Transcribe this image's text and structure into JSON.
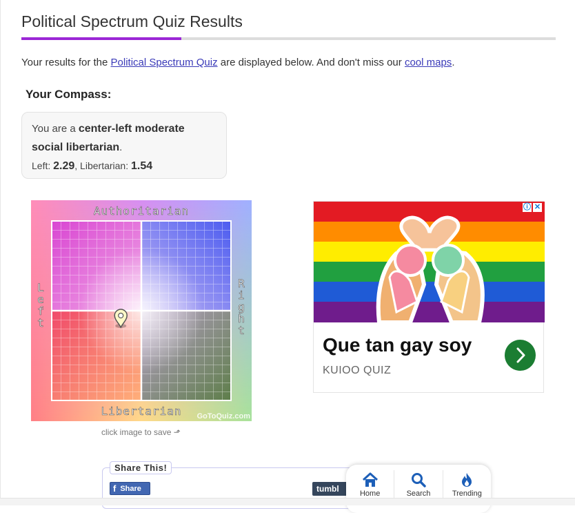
{
  "page": {
    "title": "Political Spectrum Quiz Results",
    "intro_before": "Your results for the ",
    "intro_link_quiz": "Political Spectrum Quiz",
    "intro_middle": " are displayed below. And don't miss our ",
    "intro_link_maps": "cool maps",
    "intro_after": ".",
    "compass_heading": "Your Compass:"
  },
  "result": {
    "prefix": "You are a ",
    "label": "center-left moderate social libertarian",
    "suffix": ".",
    "left_label": "Left: ",
    "left_value": "2.29",
    "separator": ", Libertarian: ",
    "libertarian_value": "1.54"
  },
  "compass": {
    "top_label": "Authoritarian",
    "bottom_label": "Libertarian",
    "left_label": "Left",
    "right_label": "Right",
    "watermark": "GoToQuiz.com",
    "caption": "click image to save ⬏",
    "marker_left_score": 2.29,
    "marker_libertarian_score": 1.54
  },
  "ad": {
    "title": "Que tan gay soy",
    "source": "KUIOO QUIZ",
    "info_icon": "info-icon",
    "close_icon": "close-icon"
  },
  "share": {
    "label": "Share This!",
    "facebook": "Share",
    "tumblr": "tumbl"
  },
  "nav": {
    "home": "Home",
    "search": "Search",
    "trending": "Trending"
  },
  "colors": {
    "accent": "#9b27d6",
    "link": "#3a3ab8",
    "facebook": "#4267b2",
    "nav_icon": "#1d5fb8"
  }
}
